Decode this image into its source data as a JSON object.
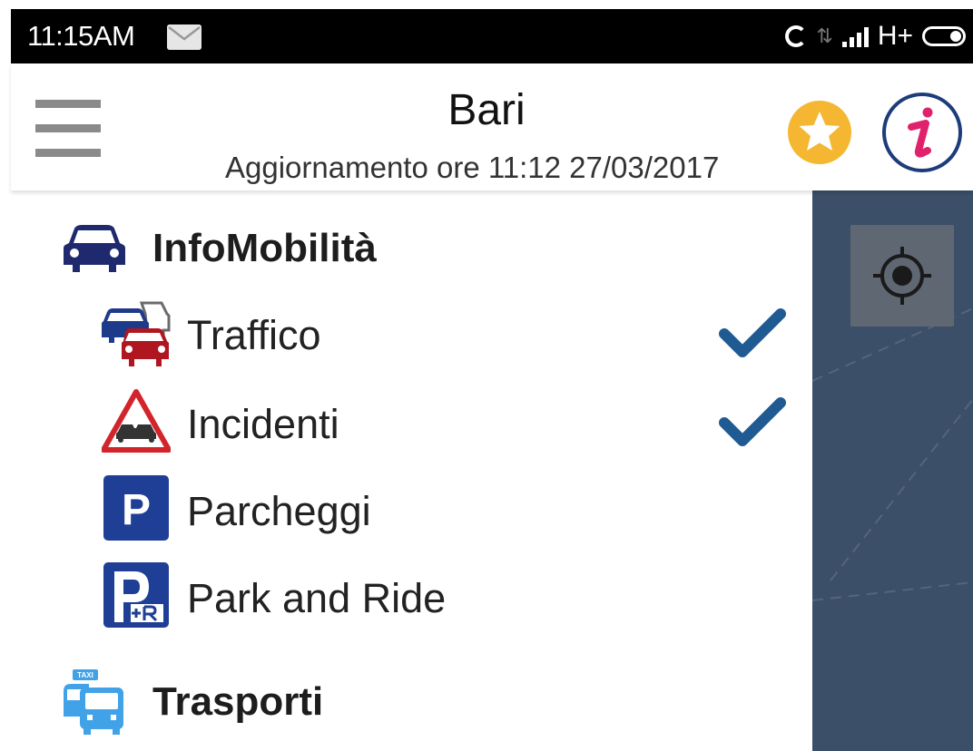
{
  "status_bar": {
    "time": "11:15AM",
    "network": "H+"
  },
  "header": {
    "title": "Bari",
    "subtitle": "Aggiornamento ore 11:12 27/03/2017"
  },
  "drawer": {
    "sections": [
      {
        "label": "InfoMobilità",
        "icon": "car-icon",
        "items": [
          {
            "label": "Traffico",
            "icon": "traffic-icon",
            "checked": true
          },
          {
            "label": "Incidenti",
            "icon": "accident-warning-icon",
            "checked": true
          },
          {
            "label": "Parcheggi",
            "icon": "parking-icon",
            "checked": false
          },
          {
            "label": "Park and Ride",
            "icon": "park-and-ride-icon",
            "checked": false
          }
        ]
      },
      {
        "label": "Trasporti",
        "icon": "taxi-bus-icon",
        "items": []
      }
    ]
  },
  "colors": {
    "status_bar": "#000000",
    "map": "#3c4f68",
    "check": "#1f5a93",
    "favorite": "#f5b731",
    "info_ring": "#1c3c7a",
    "info_letter": "#e0226c",
    "parking_blue": "#1e3f95",
    "accident_red": "#d1242b",
    "taxi_blue": "#42a2e8"
  }
}
